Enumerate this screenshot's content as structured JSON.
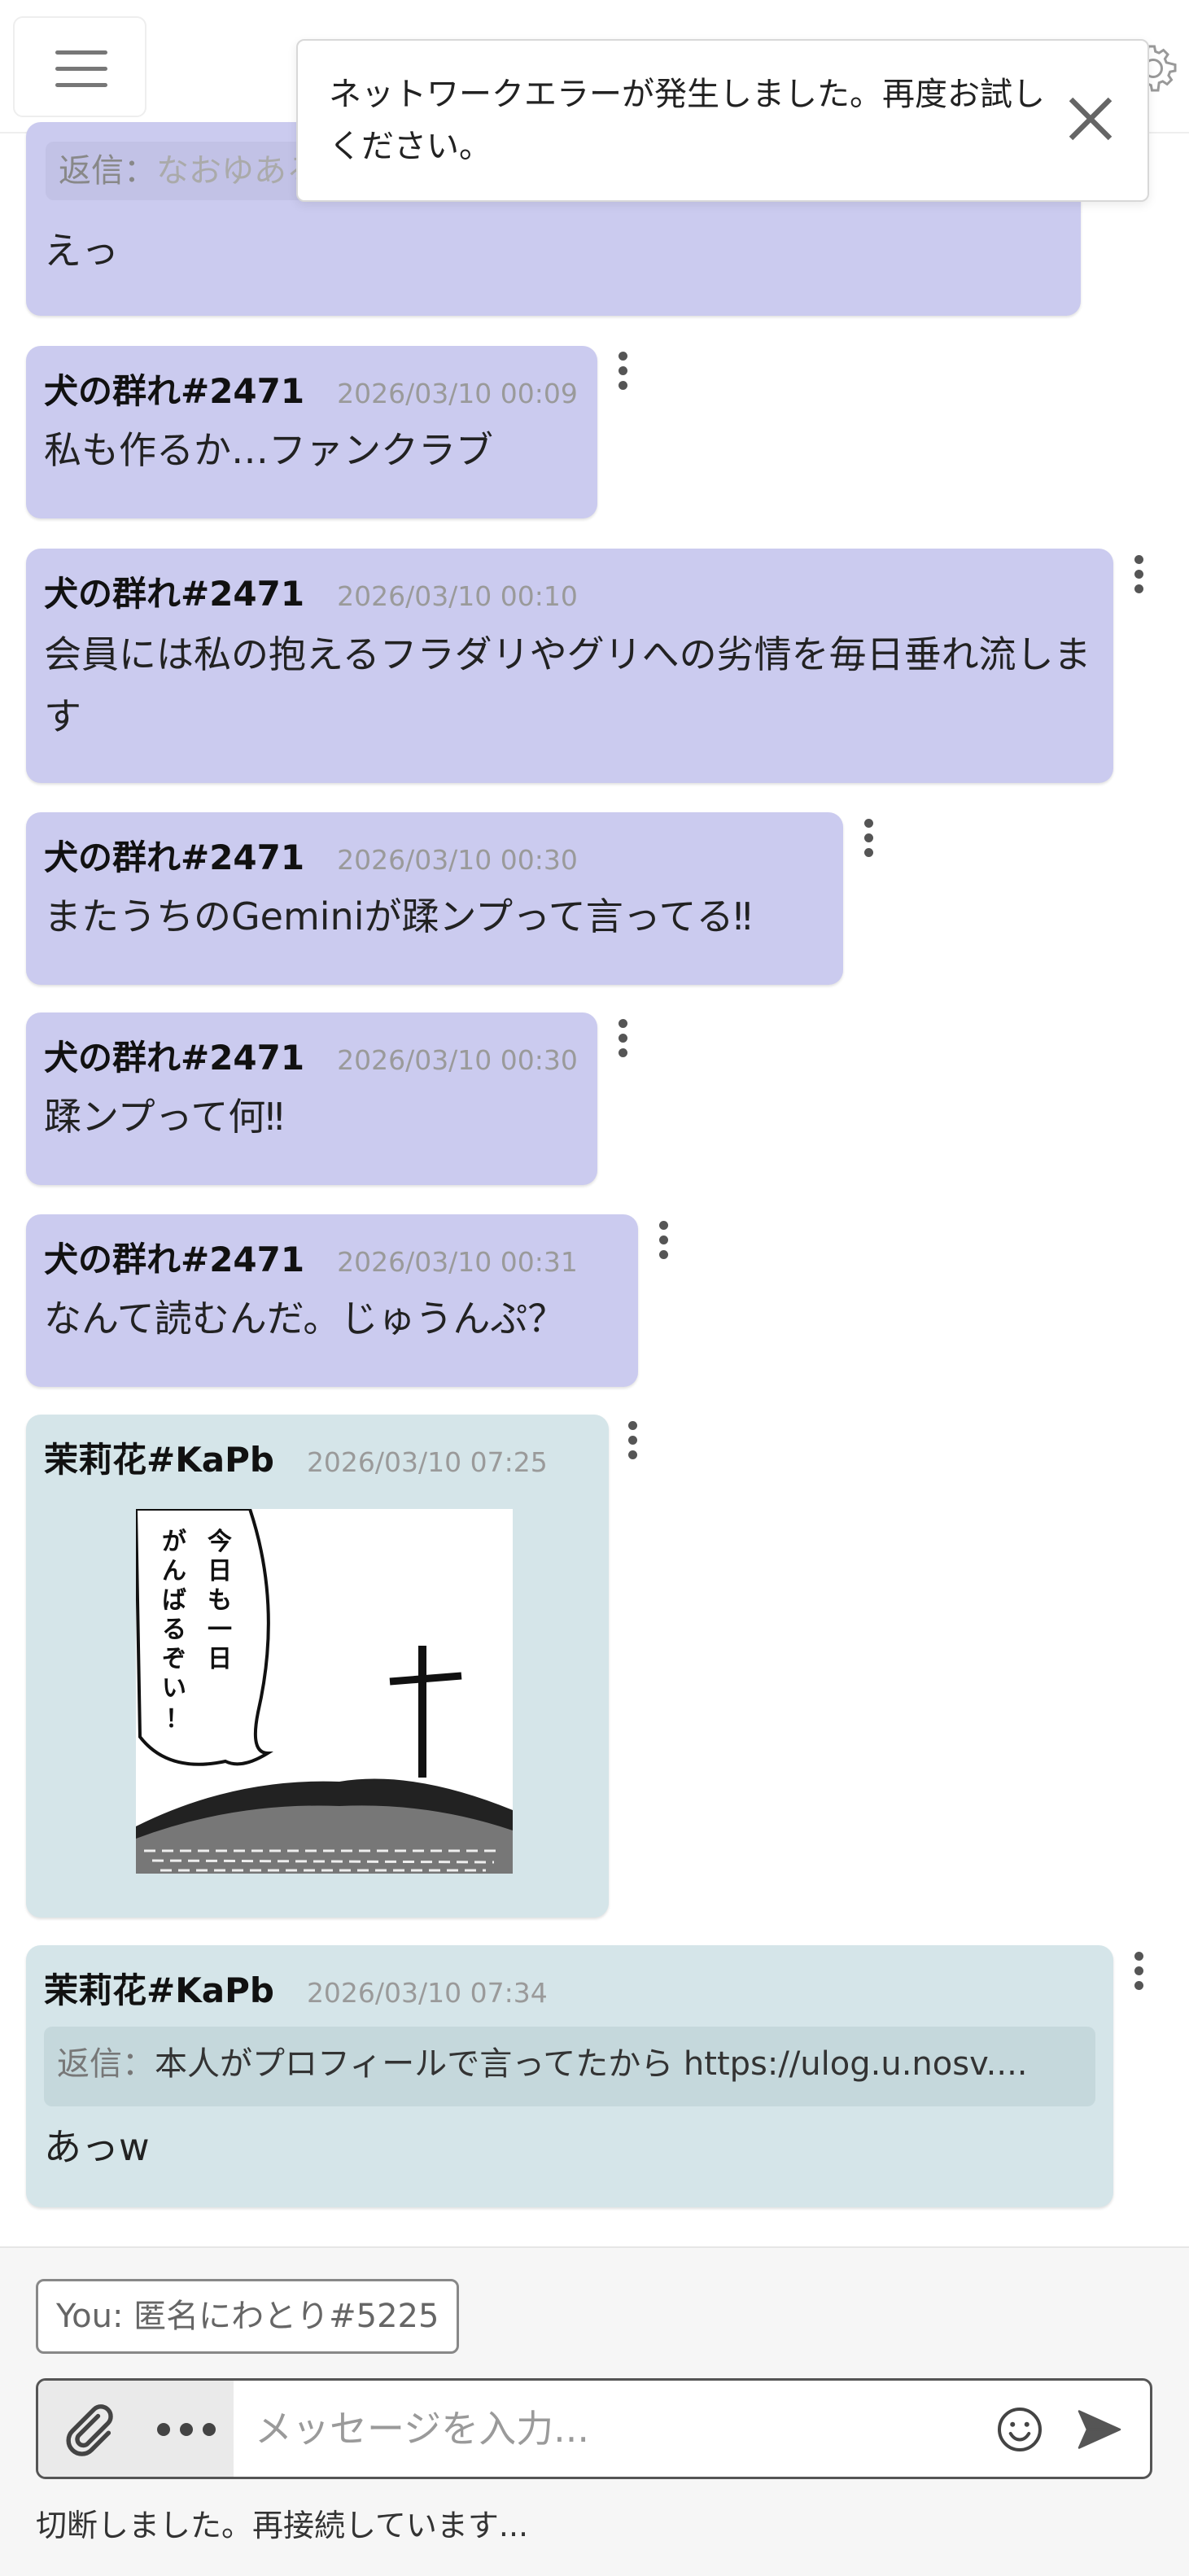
{
  "toast": {
    "message": "ネットワークエラーが発生しました。再度お試しください。"
  },
  "messages": [
    {
      "author": "",
      "time": "",
      "reply_label": "返信：",
      "reply_text": "なおゆあるーむちゃん、ついにファンクラブ設立した模様",
      "text": "えっ"
    },
    {
      "author": "犬の群れ#2471",
      "time": "2026/03/10 00:09",
      "text": "私も作るか…ファンクラブ"
    },
    {
      "author": "犬の群れ#2471",
      "time": "2026/03/10 00:10",
      "text": "会員には私の抱えるフラダリやグリへの劣情を毎日垂れ流します"
    },
    {
      "author": "犬の群れ#2471",
      "time": "2026/03/10 00:30",
      "text": "またうちのGeminiが蹂ンプって言ってる‼"
    },
    {
      "author": "犬の群れ#2471",
      "time": "2026/03/10 00:30",
      "text": "蹂ンプって何‼"
    },
    {
      "author": "犬の群れ#2471",
      "time": "2026/03/10 00:31",
      "text": "なんて読むんだ。じゅうんぷ？"
    },
    {
      "author": "茉莉花#KaPb",
      "time": "2026/03/10 07:25",
      "image_caption": "今日も一日がんばるぞい！"
    },
    {
      "author": "茉莉花#KaPb",
      "time": "2026/03/10 07:34",
      "reply_label": "返信：",
      "reply_text": "本人がプロフィールで言ってたから https://ulog.u.nosv....",
      "text": "あっw"
    }
  ],
  "composer": {
    "you_label": "You: 匿名にわとり#5225",
    "placeholder": "メッセージを入力...",
    "status": "切断しました。再接続しています..."
  },
  "icons": [
    "menu-icon",
    "gear-icon",
    "close-icon",
    "kebab-menu-icon",
    "attachment-icon",
    "more-icon",
    "emoji-icon",
    "send-icon"
  ],
  "colors": {
    "message_purple": "#cbcbef",
    "message_teal": "#d5e5e9"
  }
}
